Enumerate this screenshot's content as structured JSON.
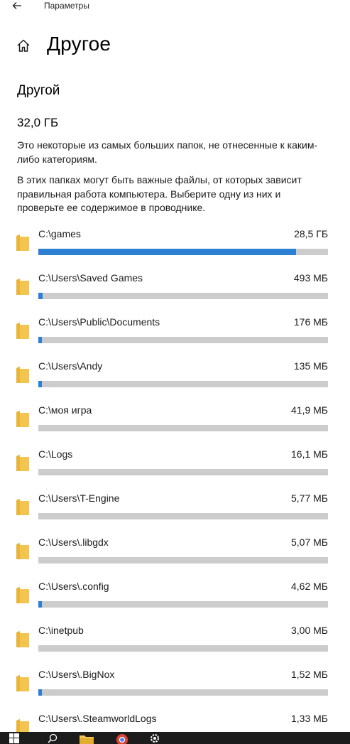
{
  "window": {
    "app_title": "Параметры",
    "back_icon": "back-arrow-icon",
    "home_icon": "home-icon"
  },
  "page": {
    "title": "Другое",
    "section_title": "Другой",
    "total_size": "32,0 ГБ",
    "description_1": "Это некоторые из самых больших папок, не отнесенные к каким-либо категориям.",
    "description_2": "В этих папках могут быть важные файлы, от которых зависит правильная работа компьютера. Выберите одну из них и проверьте ее содержимое в проводнике."
  },
  "colors": {
    "accent": "#2d7fd1",
    "track": "#cccccc",
    "folder": "#f3c54f",
    "taskbar": "#1c1c1c"
  },
  "folders": [
    {
      "path": "C:\\games",
      "size": "28,5 ГБ",
      "fraction": 0.89
    },
    {
      "path": "C:\\Users\\Saved Games",
      "size": "493 МБ",
      "fraction": 0.015
    },
    {
      "path": "C:\\Users\\Public\\Documents",
      "size": "176 МБ",
      "fraction": 0.006
    },
    {
      "path": "C:\\Users\\Andy",
      "size": "135 МБ",
      "fraction": 0.005
    },
    {
      "path": "C:\\моя игра",
      "size": "41,9 МБ",
      "fraction": 0.0
    },
    {
      "path": "C:\\Logs",
      "size": "16,1 МБ",
      "fraction": 0.0
    },
    {
      "path": "C:\\Users\\T-Engine",
      "size": "5,77 МБ",
      "fraction": 0.0
    },
    {
      "path": "C:\\Users\\.libgdx",
      "size": "5,07 МБ",
      "fraction": 0.0
    },
    {
      "path": "C:\\Users\\.config",
      "size": "4,62 МБ",
      "fraction": 0.005
    },
    {
      "path": "C:\\inetpub",
      "size": "3,00 МБ",
      "fraction": 0.0
    },
    {
      "path": "C:\\Users\\.BigNox",
      "size": "1,52 МБ",
      "fraction": 0.005
    },
    {
      "path": "C:\\Users\\.SteamworldLogs",
      "size": "1,33 МБ",
      "fraction": 0.0
    }
  ],
  "taskbar": {
    "items": [
      "windows-start-icon",
      "search-icon",
      "file-explorer-icon",
      "browser-icon",
      "settings-icon"
    ]
  }
}
